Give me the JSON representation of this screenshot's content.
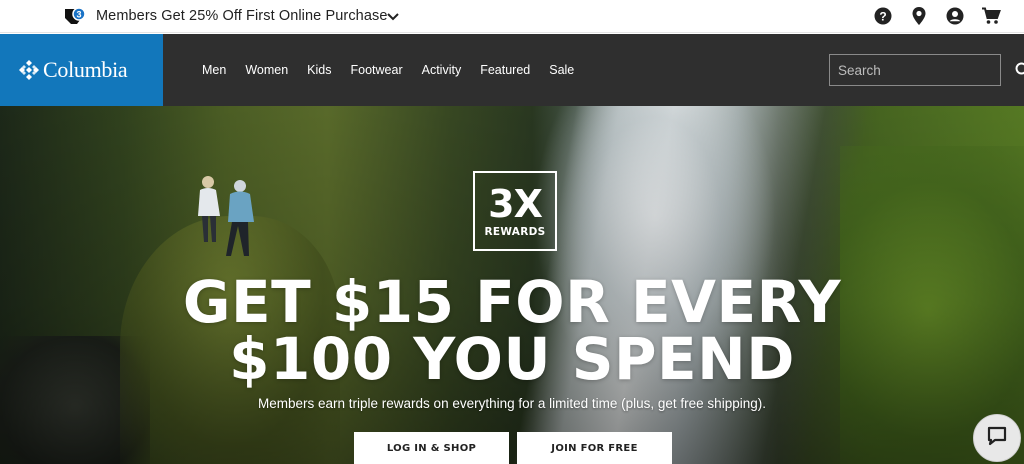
{
  "promo": {
    "badge_count": "3",
    "text": "Members Get 25% Off First Online Purchase",
    "tag_icon": "tag-icon",
    "expand_icon": "chevron-down-icon"
  },
  "utility_icons": [
    "help-icon",
    "location-pin-icon",
    "account-icon",
    "cart-icon"
  ],
  "brand": {
    "name": "Columbia",
    "color": "#1277bb",
    "nav_background": "#2f2f2f"
  },
  "nav": {
    "links": [
      "Men",
      "Women",
      "Kids",
      "Footwear",
      "Activity",
      "Featured",
      "Sale"
    ]
  },
  "search": {
    "placeholder": "Search",
    "value": "",
    "icon": "search-icon"
  },
  "hero": {
    "badge_big": "3X",
    "badge_small": "REWARDS",
    "headline_line1": "GET $15 FOR EVERY",
    "headline_line2": "$100 YOU SPEND",
    "subline": "Members earn triple rewards on everything for a limited time (plus, get free shipping).",
    "buttons": {
      "login": "LOG IN & SHOP",
      "join": "JOIN FOR FREE"
    }
  },
  "chat": {
    "icon": "chat-bubble-icon"
  }
}
